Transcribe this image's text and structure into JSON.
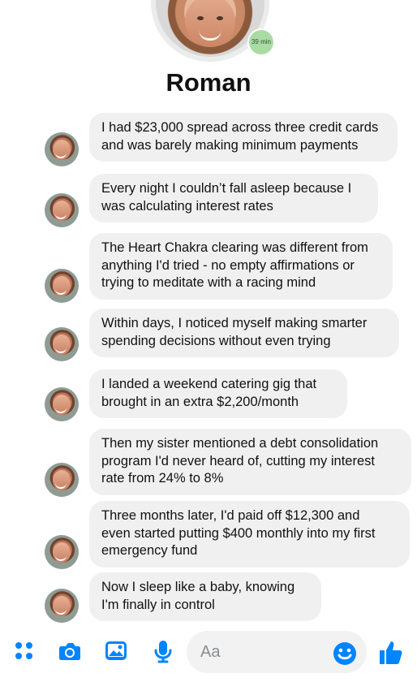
{
  "profile": {
    "name": "Roman",
    "status": "39 min"
  },
  "messages": [
    {
      "text": "I had $23,000 spread across three credit cards\nand was barely making minimum payments"
    },
    {
      "text": "Every night I couldn’t fall asleep because I\nwas calculating interest rates"
    },
    {
      "text": "The Heart Chakra clearing was different from\nanything I'd tried - no empty affirmations or\ntrying to meditate with a racing mind"
    },
    {
      "text": "Within days, I noticed myself making smarter\nspending decisions without even trying"
    },
    {
      "text": "I landed a weekend catering gig that\nbrought in an extra $2,200/month"
    },
    {
      "text": "Then my sister mentioned a debt consolidation\nprogram I'd never heard of, cutting my interest\nrate from 24% to 8%"
    },
    {
      "text": "Three months later, I'd paid off $12,300 and\neven started putting $400 monthly into my first\nemergency fund"
    },
    {
      "text": "Now I sleep like a baby, knowing\nI'm finally in control"
    }
  ],
  "composer": {
    "placeholder": "Aa",
    "accent_color": "#0084ff",
    "icons": [
      "apps-icon",
      "camera-icon",
      "image-icon",
      "microphone-icon",
      "emoji-icon",
      "thumbs-up-icon"
    ]
  }
}
